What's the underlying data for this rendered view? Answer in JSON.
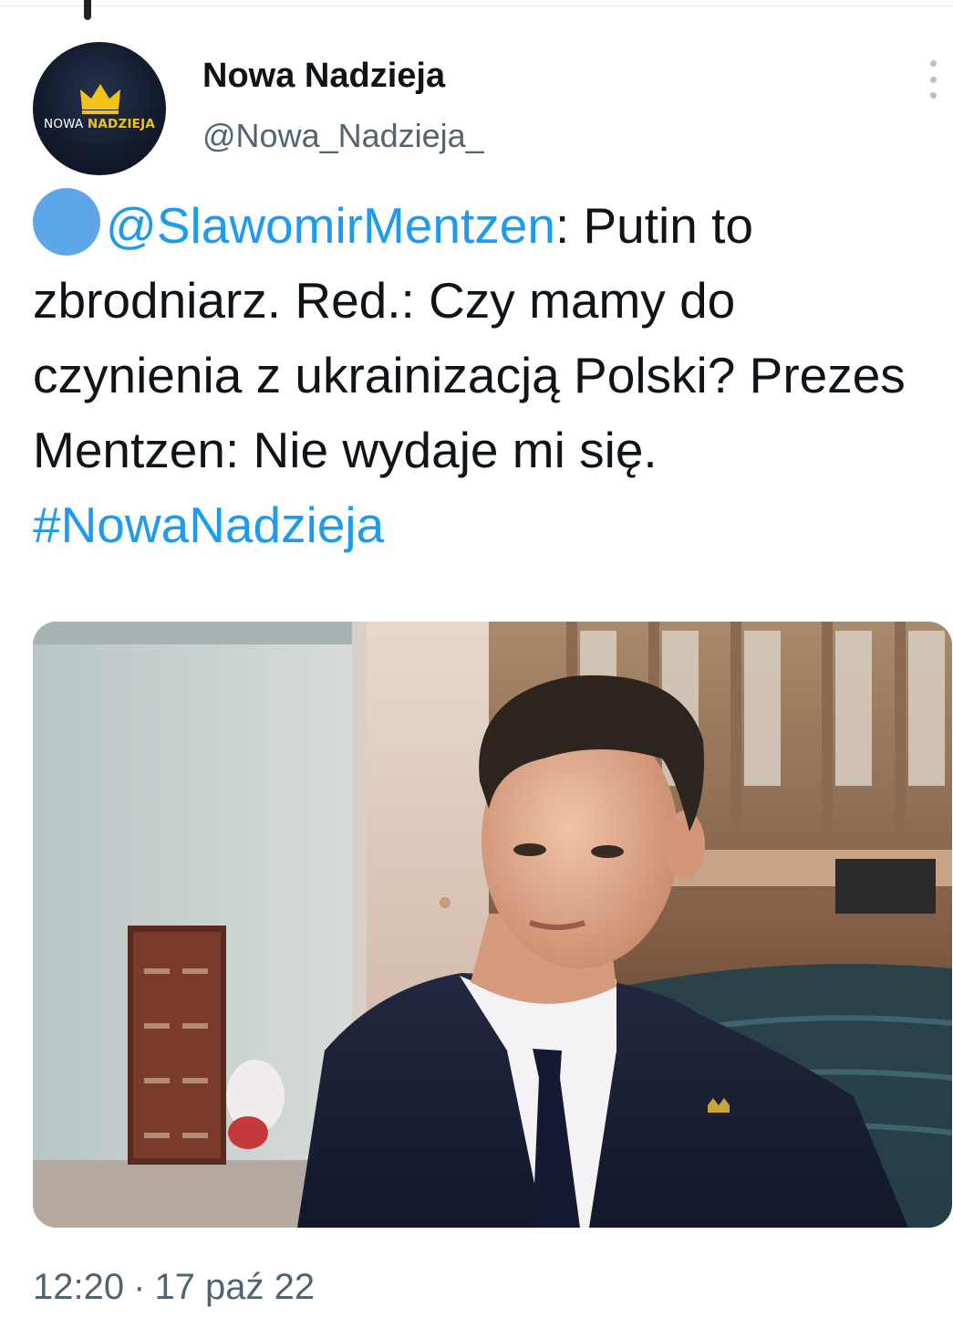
{
  "tweet": {
    "author": {
      "display_name": "Nowa Nadzieja",
      "handle": "@Nowa_Nadzieja_",
      "avatar": {
        "logo_text_light": "NOWA",
        "logo_text_bold": "NADZIEJA",
        "icon": "crown-icon",
        "accent_color": "#f2c21b",
        "background_color": "#121a2c"
      }
    },
    "menu_icon": "more-dots-icon",
    "body": {
      "emoji": "blue-circle",
      "mention": "@SlawomirMentzen",
      "text_after_mention": ": Putin to zbrodniarz. Red.: Czy mamy do czynienia z ukrainizacją Polski? Prezes Mentzen: Nie wydaje mi się. ",
      "hashtag": "#NowaNadzieja"
    },
    "media": {
      "kind": "photo",
      "subject": "man in dark suit and tie in parliament chamber"
    },
    "time": "12:20",
    "separator": "·",
    "date": "17 paź 22"
  },
  "colors": {
    "link": "#1d9bf0",
    "secondary_text": "#536471",
    "primary_text": "#0f1419"
  }
}
